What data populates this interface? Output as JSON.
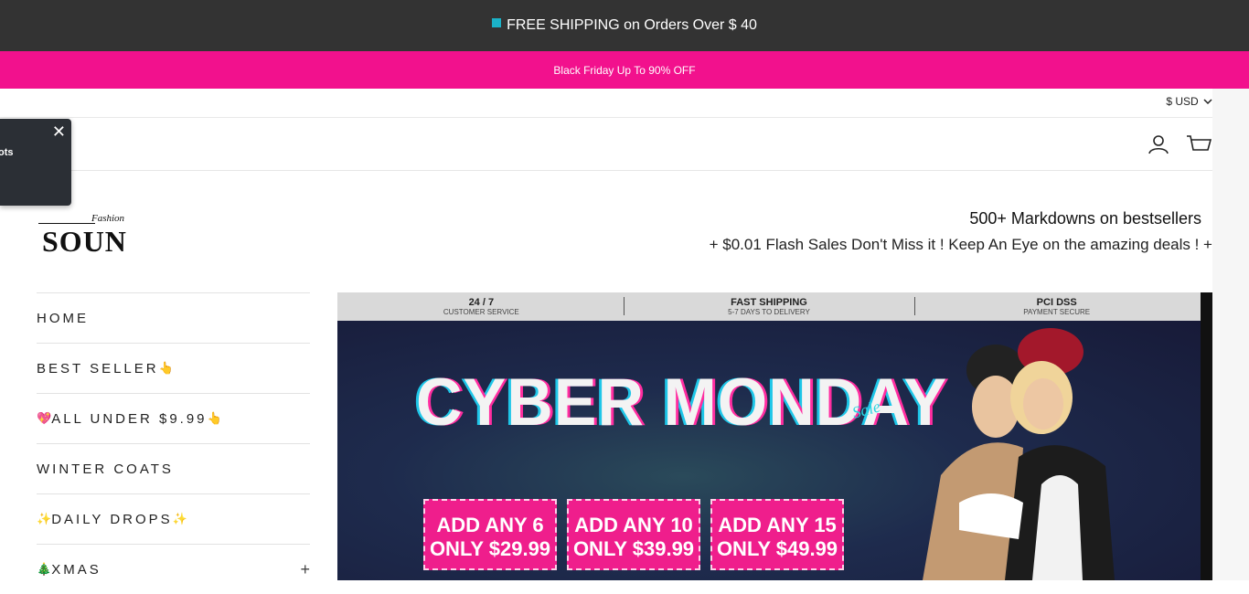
{
  "announcement": {
    "text": "FREE SHIPPING on Orders Over $ 40"
  },
  "promo_bar": {
    "text": "Black Friday Up To 90% OFF"
  },
  "currency": {
    "label": "$ USD"
  },
  "popup": {
    "text": "ots",
    "close": "✕"
  },
  "logo": {
    "brand": "SOUN",
    "script": "Fashion"
  },
  "promo": {
    "line1": "500+ Markdowns on bestsellers",
    "line2": "+ $0.01 Flash Sales Don't Miss it !  Keep An Eye on the amazing deals ! +"
  },
  "nav": {
    "items": [
      {
        "label": "HOME"
      },
      {
        "label": "BEST SELLER",
        "suffix": "👆"
      },
      {
        "prefix": "💖",
        "label": "ALL UNDER $9.99",
        "suffix": "👆"
      },
      {
        "label": "WINTER COATS"
      },
      {
        "prefix": "✨",
        "label": "DAILY DROPS",
        "suffix": "✨"
      },
      {
        "prefix": "🎄",
        "label": "XMAS",
        "expand": "+"
      }
    ]
  },
  "banner": {
    "info": [
      {
        "title": "24 / 7",
        "sub": "CUSTOMER SERVICE"
      },
      {
        "title": "FAST SHIPPING",
        "sub": "5-7 DAYS TO DELIVERY"
      },
      {
        "title": "PCI DSS",
        "sub": "PAYMENT SECURE"
      }
    ],
    "headline": "CYBER MONDAY",
    "sale_tag": "Sale",
    "offers": [
      {
        "line1": "ADD ANY 6",
        "line2": "ONLY $29.99"
      },
      {
        "line1": "ADD ANY 10",
        "line2": "ONLY $39.99"
      },
      {
        "line1": "ADD ANY 15",
        "line2": "ONLY $49.99"
      }
    ]
  },
  "colors": {
    "top_bar": "#333333",
    "promo_bar": "#f2118d",
    "ticket": "#ef1e8c"
  }
}
